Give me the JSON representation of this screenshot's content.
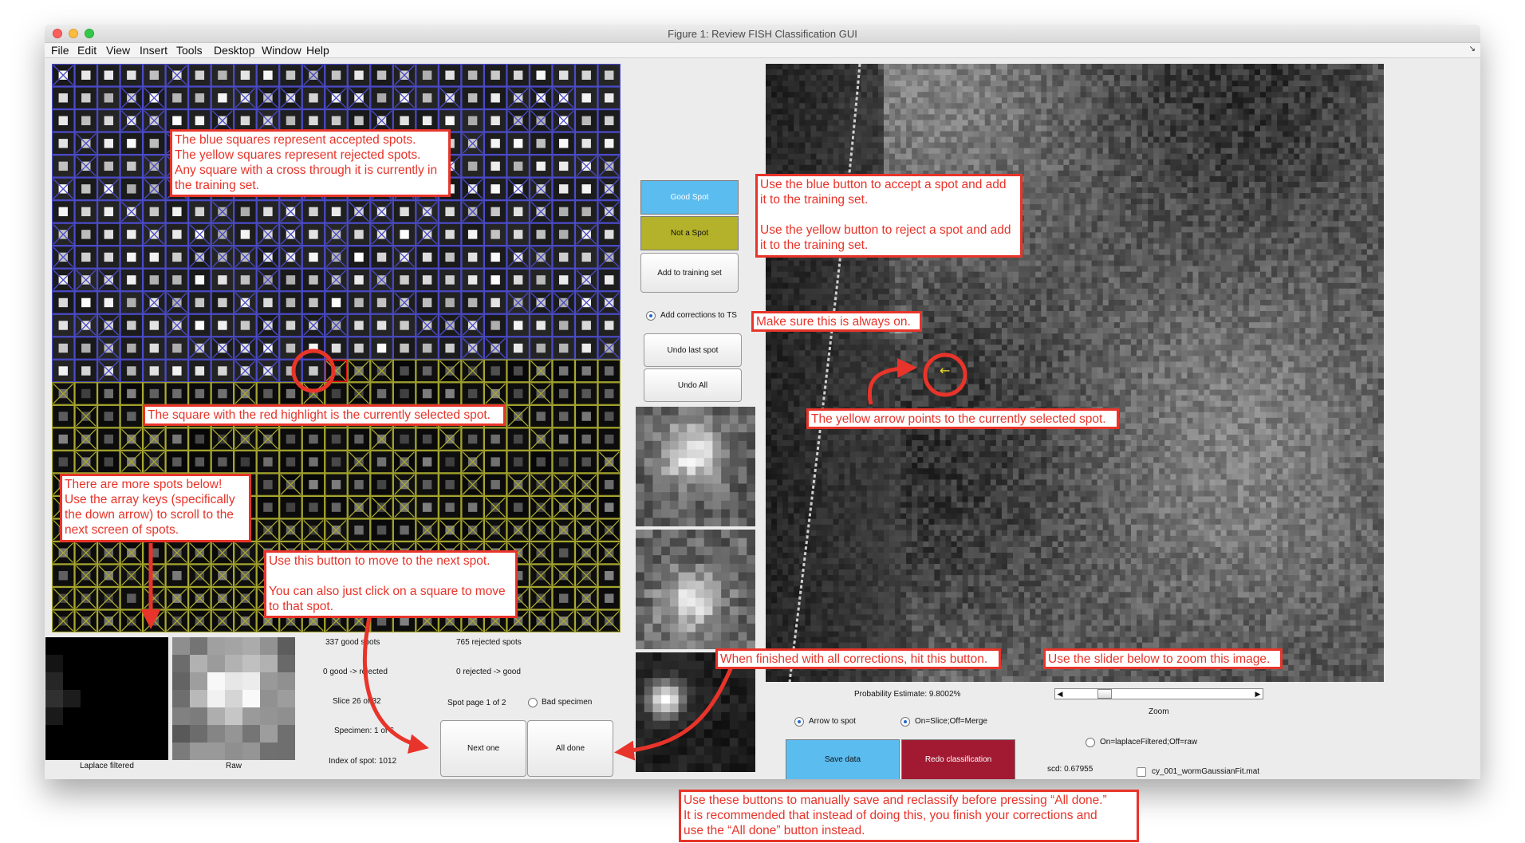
{
  "window": {
    "title": "Figure 1: Review FISH Classification GUI"
  },
  "menu": [
    "File",
    "Edit",
    "View",
    "Insert",
    "Tools",
    "Desktop",
    "Window",
    "Help"
  ],
  "left_panel": {
    "thumb_labels": {
      "laplace": "Laplace filtered",
      "raw": "Raw"
    },
    "status": {
      "good_spots": "337 good spots",
      "rejected_spots": "765 rejected spots",
      "good_to_rejected": "0 good -> rejected",
      "rejected_to_good": "0 rejected -> good",
      "slice": "Slice 26 of 32",
      "spot_page": "Spot page 1 of 2",
      "specimen": "Specimen: 1 of 6",
      "index": "Index of spot: 1012"
    },
    "bad_specimen_label": "Bad specimen",
    "next_button": "Next one",
    "done_button": "All done"
  },
  "middle_panel": {
    "good_button": "Good Spot",
    "not_button": "Not a Spot",
    "add_ts_button": "Add to training set",
    "add_corrections_label": "Add corrections to TS",
    "undo_last": "Undo last spot",
    "undo_all": "Undo All"
  },
  "right_panel": {
    "probability": "Probability Estimate: 9.8002%",
    "zoom_label": "Zoom",
    "arrow_to_spot": "Arrow to spot",
    "slice_merge": "On=Slice;Off=Merge",
    "laplace_raw": "On=laplaceFiltered;Off=raw",
    "save_button": "Save data",
    "redo_button": "Redo classification",
    "scd": "scd: 0.67955",
    "mat_file": "cy_001_wormGaussianFit.mat"
  },
  "annotations": {
    "squares": "The blue squares represent accepted spots.\nThe yellow squares represent rejected spots.\nAny square with a cross through it is currently in\nthe training set.",
    "red_square": "The square with the red highlight is the currently selected spot.",
    "more_spots": "There are more spots below!\nUse the array keys (specifically\nthe down arrow) to scroll to the\nnext screen of spots.",
    "next_button": "Use this button to move to the next spot.\n\nYou can also just click on a square to move\nto that spot.",
    "blue_yellow": "Use the blue button to accept a spot and add\nit to the training set.\n\nUse the yellow button to reject a spot and add\nit to the training set.",
    "always_on": "Make sure this is always on.",
    "yellow_arrow": "The yellow arrow points to the currently selected spot.",
    "finished": "When finished with all corrections, hit this button.",
    "slider": "Use the slider below to zoom this image.",
    "save_redo": "Use these buttons to manually save and reclassify before pressing “All done.”\nIt is recommended that instead of doing this, you finish your corrections and\nuse the “All done” button instead."
  },
  "colors": {
    "accent_red": "#e8342a",
    "accepted_blue": "#4b4bc8",
    "rejected_yellow": "#a8a830",
    "good_button": "#5bbcf0",
    "not_button": "#b3b22a",
    "save_button": "#5bbcf0",
    "redo_button": "#a11a32"
  },
  "icons": [
    "close-icon",
    "minimize-icon",
    "zoom-icon",
    "dock-arrow-icon",
    "slider-left-arrow-icon",
    "slider-right-arrow-icon",
    "selected-spot-arrow-icon"
  ]
}
